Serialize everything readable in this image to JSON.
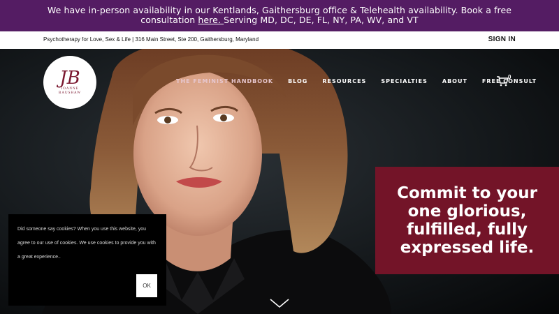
{
  "announcement": {
    "text_before": "We have in-person availability in our Kentlands, Gaithersburg office & Telehealth availability.  Book a free consultation ",
    "link": "here. ",
    "text_after": "Serving MD, DC, DE, FL, NY, PA, WV, and VT"
  },
  "topbar": {
    "address": "Psychotherapy for Love, Sex & Life | 316 Main Street, Ste 200, Gaithersburg, Maryland",
    "signin": "SIGN IN"
  },
  "logo": {
    "monogram": "JB",
    "name_line1": "JOANNE",
    "name_line2": "BAUSHAW"
  },
  "nav": {
    "items": [
      "THE FEMINIST HANDBOOK",
      "BLOG",
      "RESOURCES",
      "SPECIALTIES",
      "ABOUT",
      "FREE CONSULT"
    ],
    "cart_count": "0",
    "cart_icon": "cart-icon"
  },
  "hero": {
    "tagline": "Commit to your one glorious, fulfilled, fully expressed life.",
    "tagline_bg": "#731428"
  },
  "cookie": {
    "message": "Did someone say cookies? When you use this website, you agree to our use of cookies. We use cookies to provide you with a great experience..",
    "ok_label": "OK"
  },
  "colors": {
    "announcement_bg": "#541c63",
    "brand": "#7b1830"
  }
}
